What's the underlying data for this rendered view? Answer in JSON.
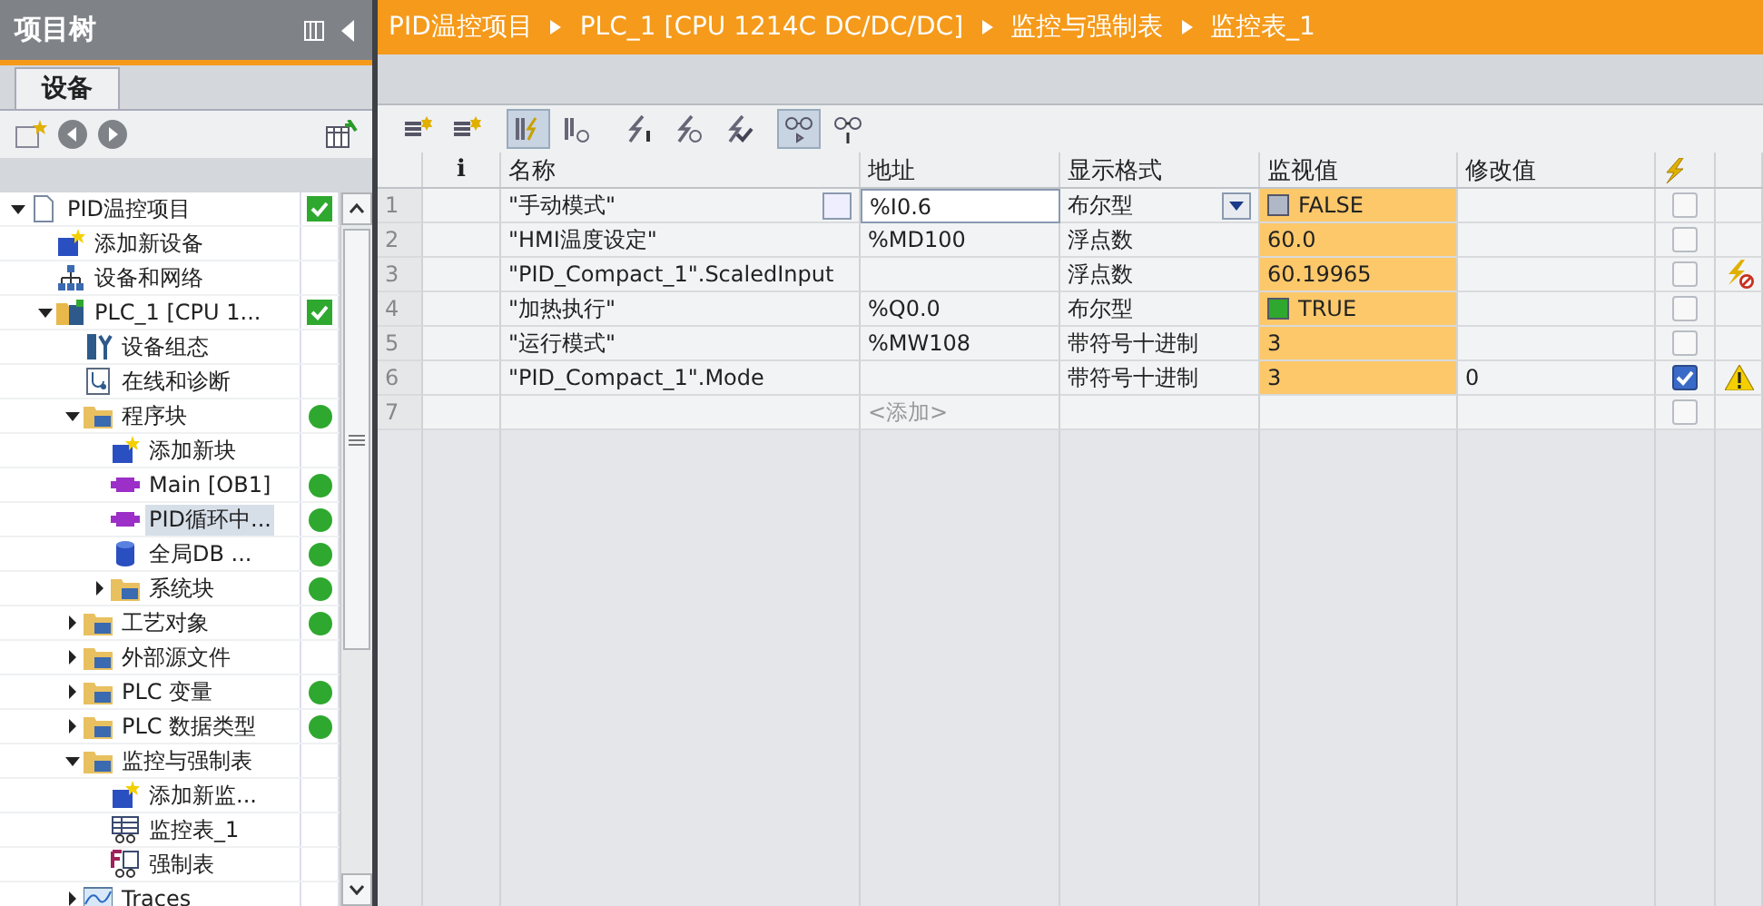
{
  "project_tree": {
    "title": "项目树",
    "tab": "设备",
    "items": [
      {
        "label": "PID温控项目",
        "kind": "project",
        "status": {
          "kind": "check"
        },
        "selected": false,
        "expanded": true,
        "children": [
          {
            "label": "添加新设备",
            "kind": "add",
            "selected": false
          },
          {
            "label": "设备和网络",
            "kind": "network",
            "selected": false
          },
          {
            "label": "PLC_1 [CPU 1...",
            "kind": "plc",
            "status": {
              "kind": "check"
            },
            "selected": false,
            "expanded": true,
            "children": [
              {
                "label": "设备组态",
                "kind": "config",
                "selected": false
              },
              {
                "label": "在线和诊断",
                "kind": "diag",
                "selected": false
              },
              {
                "label": "程序块",
                "kind": "folder",
                "status": {
                  "kind": "dot"
                },
                "selected": false,
                "expanded": true,
                "children": [
                  {
                    "label": "添加新块",
                    "kind": "add",
                    "selected": false
                  },
                  {
                    "label": "Main [OB1]",
                    "kind": "block",
                    "status": {
                      "kind": "dot"
                    },
                    "selected": false
                  },
                  {
                    "label": "PID循环中...",
                    "kind": "block",
                    "status": {
                      "kind": "dot"
                    },
                    "selected": true
                  },
                  {
                    "label": "全局DB ...",
                    "kind": "db",
                    "status": {
                      "kind": "dot"
                    },
                    "selected": false
                  },
                  {
                    "label": "系统块",
                    "kind": "folder",
                    "status": {
                      "kind": "dot"
                    },
                    "selected": false,
                    "expanded": false
                  }
                ]
              },
              {
                "label": "工艺对象",
                "kind": "folder",
                "status": {
                  "kind": "dot"
                },
                "selected": false,
                "expanded": false
              },
              {
                "label": "外部源文件",
                "kind": "folder",
                "selected": false,
                "expanded": false
              },
              {
                "label": "PLC 变量",
                "kind": "folder",
                "status": {
                  "kind": "dot"
                },
                "selected": false,
                "expanded": false
              },
              {
                "label": "PLC 数据类型",
                "kind": "folder",
                "status": {
                  "kind": "dot"
                },
                "selected": false,
                "expanded": false
              },
              {
                "label": "监控与强制表",
                "kind": "folder",
                "selected": false,
                "expanded": true,
                "children": [
                  {
                    "label": "添加新监...",
                    "kind": "add",
                    "selected": false
                  },
                  {
                    "label": "监控表_1",
                    "kind": "table",
                    "selected": false
                  },
                  {
                    "label": "强制表",
                    "kind": "force-table",
                    "selected": false
                  }
                ]
              },
              {
                "label": "Traces",
                "kind": "trace",
                "selected": false,
                "expanded": false
              }
            ]
          }
        ]
      }
    ]
  },
  "breadcrumb": [
    "PID温控项目",
    "PLC_1 [CPU 1214C DC/DC/DC]",
    "监控与强制表",
    "监控表_1"
  ],
  "toolbar": [
    {
      "pressed": false
    },
    {
      "pressed": false
    },
    {
      "pressed": true
    },
    {
      "pressed": false
    },
    {
      "pressed": false
    },
    {
      "pressed": false
    },
    {
      "pressed": false
    },
    {
      "pressed": true
    },
    {
      "pressed": false
    }
  ],
  "table": {
    "columns": [
      "i",
      "名称",
      "地址",
      "显示格式",
      "监视值",
      "修改值"
    ],
    "rows": [
      {
        "index": "1",
        "name": "\"手动模式\"",
        "address": "%I0.6",
        "format": "布尔型",
        "monitor": {
          "value": "FALSE",
          "kind": "bool",
          "on": false
        },
        "selected": true,
        "checked": false
      },
      {
        "index": "2",
        "name": "\"HMI温度设定\"",
        "address": "%MD100",
        "format": "浮点数",
        "monitor": {
          "value": "60.0",
          "kind": "number"
        },
        "selected": false,
        "checked": false
      },
      {
        "index": "3",
        "name": "\"PID_Compact_1\".ScaledInput",
        "address": "",
        "format": "浮点数",
        "monitor": {
          "value": "60.19965",
          "kind": "number"
        },
        "selected": false,
        "checked": false,
        "status": {
          "kind": "blocked"
        }
      },
      {
        "index": "4",
        "name": "\"加热执行\"",
        "address": "%Q0.0",
        "format": "布尔型",
        "monitor": {
          "value": "TRUE",
          "kind": "bool",
          "on": true
        },
        "selected": false,
        "checked": false
      },
      {
        "index": "5",
        "name": "\"运行模式\"",
        "address": "%MW108",
        "format": "带符号十进制",
        "monitor": {
          "value": "3",
          "kind": "number"
        },
        "selected": false,
        "checked": false
      },
      {
        "index": "6",
        "name": "\"PID_Compact_1\".Mode",
        "address": "",
        "format": "带符号十进制",
        "monitor": {
          "value": "3",
          "kind": "number"
        },
        "modify": "0",
        "selected": false,
        "checked": true,
        "status": {
          "kind": "warning"
        }
      },
      {
        "index": "7",
        "placeholder": "<添加>",
        "selected": false,
        "checked": false
      }
    ]
  }
}
